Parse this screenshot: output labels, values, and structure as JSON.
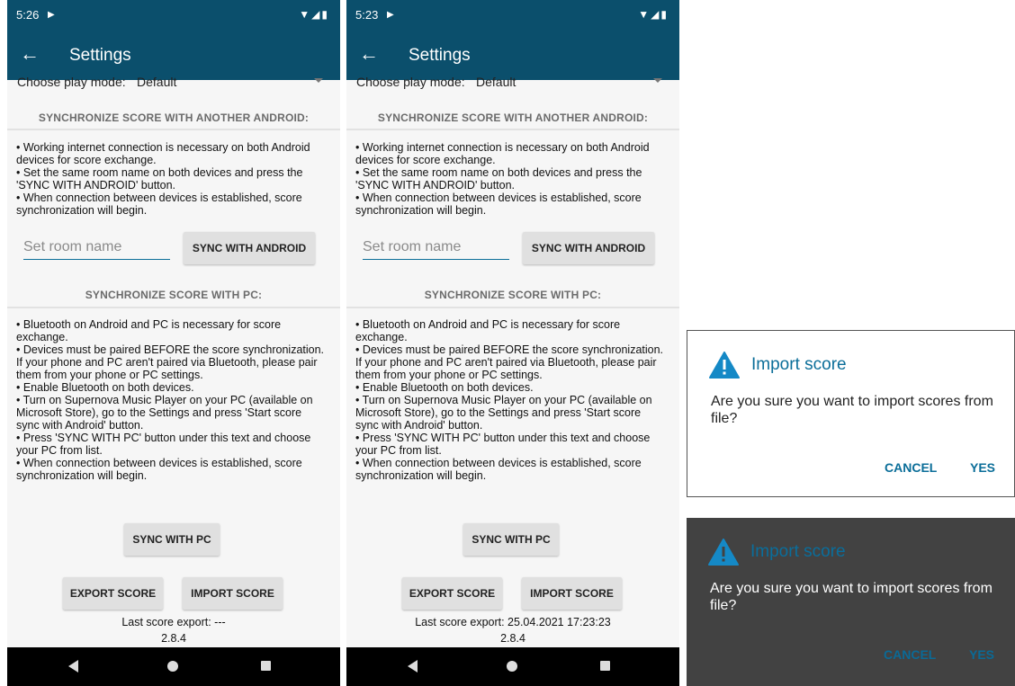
{
  "screens": [
    {
      "status_time": "5:26",
      "title": "Settings",
      "play_mode_label": "Choose play mode:",
      "play_mode_value": "Default",
      "android_section_title": "SYNCHRONIZE SCORE WITH ANOTHER ANDROID:",
      "android_instructions": [
        "• Working internet connection is necessary on both Android devices for score exchange.",
        "• Set the same room name on both devices and press the 'SYNC WITH ANDROID' button.",
        "• When connection between devices is established, score synchronization will begin."
      ],
      "room_placeholder": "Set room name",
      "sync_android_label": "SYNC WITH ANDROID",
      "pc_section_title": "SYNCHRONIZE SCORE WITH PC:",
      "pc_instructions": [
        "• Bluetooth on Android and PC is necessary for score exchange.",
        "• Devices must be paired BEFORE the score synchronization. If your phone and PC aren't paired via Bluetooth, please pair them from your phone or PC settings.",
        "• Enable Bluetooth on both devices.",
        "• Turn on Supernova Music Player on your PC (available on Microsoft Store), go to the Settings and press 'Start score sync with Android' button.",
        "• Press 'SYNC WITH PC' button under this text and choose your PC from list.",
        "• When connection between devices is established, score synchronization will begin."
      ],
      "sync_pc_label": "SYNC WITH PC",
      "export_label": "EXPORT SCORE",
      "import_label": "IMPORT SCORE",
      "last_export": "Last score export: ---",
      "version": "2.8.4"
    },
    {
      "status_time": "5:23",
      "title": "Settings",
      "play_mode_label": "Choose play mode:",
      "play_mode_value": "Default",
      "android_section_title": "SYNCHRONIZE SCORE WITH ANOTHER ANDROID:",
      "android_instructions": [
        "• Working internet connection is necessary on both Android devices for score exchange.",
        "• Set the same room name on both devices and press the 'SYNC WITH ANDROID' button.",
        "• When connection between devices is established, score synchronization will begin."
      ],
      "room_placeholder": "Set room name",
      "sync_android_label": "SYNC WITH ANDROID",
      "pc_section_title": "SYNCHRONIZE SCORE WITH PC:",
      "pc_instructions": [
        "• Bluetooth on Android and PC is necessary for score exchange.",
        "• Devices must be paired BEFORE the score synchronization. If your phone and PC aren't paired via Bluetooth, please pair them from your phone or PC settings.",
        "• Enable Bluetooth on both devices.",
        "• Turn on Supernova Music Player on your PC (available on Microsoft Store), go to the Settings and press 'Start score sync with Android' button.",
        "• Press 'SYNC WITH PC' button under this text and choose your PC from list.",
        "• When connection between devices is established, score synchronization will begin."
      ],
      "sync_pc_label": "SYNC WITH PC",
      "export_label": "EXPORT SCORE",
      "import_label": "IMPORT SCORE",
      "last_export": "Last score export: 25.04.2021 17:23:23",
      "version": "2.8.4"
    }
  ],
  "dialogs": [
    {
      "theme": "light",
      "title": "Import score",
      "message": "Are you sure you want to import scores from file?",
      "cancel_label": "CANCEL",
      "yes_label": "YES"
    },
    {
      "theme": "dark",
      "title": "Import score",
      "message": "Are you sure you want to import scores from file?",
      "cancel_label": "CANCEL",
      "yes_label": "YES"
    }
  ],
  "icons": {
    "back": "arrow-left-icon",
    "warning": "warning-icon",
    "status": [
      "play-icon",
      "wifi-icon",
      "signal-icon",
      "battery-icon"
    ],
    "nav": [
      "nav-back-icon",
      "nav-home-icon",
      "nav-recents-icon"
    ]
  },
  "colors": {
    "primary": "#0b4f6c",
    "accent": "#0b6e99",
    "warning_icon": "#1589c6",
    "button_bg": "#e0e0e0",
    "dark_dialog_bg": "#424242"
  }
}
